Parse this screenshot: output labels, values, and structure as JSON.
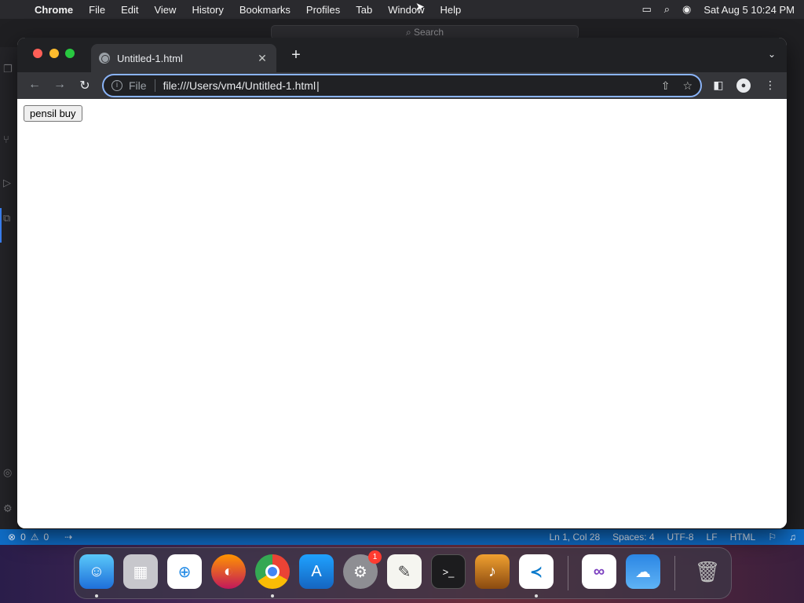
{
  "menubar": {
    "app_name": "Chrome",
    "items": [
      "File",
      "Edit",
      "View",
      "History",
      "Bookmarks",
      "Profiles",
      "Tab",
      "Window",
      "Help"
    ],
    "clock": "Sat Aug 5  10:24 PM"
  },
  "vscode": {
    "search_placeholder": "Search",
    "status": {
      "errors": "0",
      "warnings": "0",
      "position": "Ln 1, Col 28",
      "spaces": "Spaces: 4",
      "encoding": "UTF-8",
      "eol": "LF",
      "language": "HTML"
    }
  },
  "browser": {
    "tab_title": "Untitled-1.html",
    "scheme_chip": "File",
    "url": "file:///Users/vm4/Untitled-1.html"
  },
  "page": {
    "button_label": "pensil buy"
  },
  "dock": {
    "apps": [
      "finder",
      "launchpad",
      "safari",
      "firefox",
      "chrome",
      "app-store",
      "system-settings",
      "textedit",
      "terminal",
      "garageband",
      "vscode",
      "visual-studio",
      "weather",
      "trash"
    ],
    "system_settings_badge": "1"
  },
  "colors": {
    "statusbar": "#0f6cc5",
    "omnibox_focus": "#8ab4f8",
    "traffic_red": "#ff5f57",
    "traffic_yellow": "#febc2e",
    "traffic_green": "#28c840"
  }
}
